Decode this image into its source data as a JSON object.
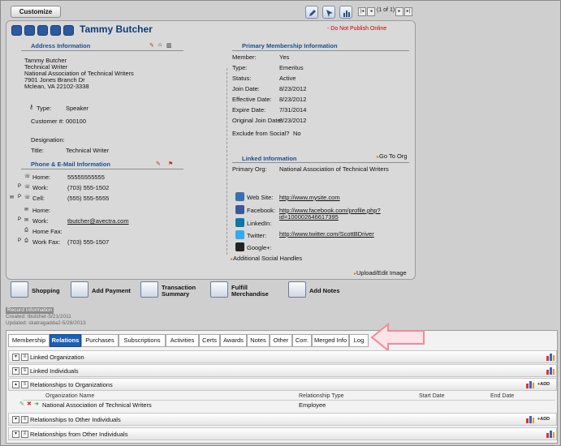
{
  "toolbar": {
    "customize_label": "Customize",
    "pager_text": "(1 of 1)",
    "icons": [
      "edit-icon",
      "pointer-icon",
      "report-chart-icon"
    ]
  },
  "record": {
    "name": "Tammy Butcher",
    "do_not_publish": "- Do Not Publish Online"
  },
  "address": {
    "section_title": "Address Information",
    "lines": [
      "Tammy Butcher",
      "Technical Writer",
      "National Association of Technical Writers",
      "7901 Jones Branch Dr",
      "Mclean, VA 22102-3338"
    ],
    "type_label": "Type:",
    "type_value": "Speaker",
    "customer_label": "Customer #:",
    "customer_value": "000100",
    "designation_label": "Designation:",
    "title_label": "Title:",
    "title_value": "Technical Writer"
  },
  "phone": {
    "section_title": "Phone & E-Mail Information",
    "rows": [
      {
        "label": "Home:",
        "value": "55555555555",
        "prefix": ""
      },
      {
        "label": "Work:",
        "value": "(703) 555-1502",
        "prefix": "P"
      },
      {
        "label": "Cell:",
        "value": "(555) 555-5555",
        "prefix": "P"
      },
      {
        "label": "Home:",
        "value": "",
        "prefix": ""
      },
      {
        "label": "Work:",
        "value": "tbutcher@avectra.com",
        "prefix": "P"
      },
      {
        "label": "Home Fax:",
        "value": "",
        "prefix": ""
      },
      {
        "label": "Work Fax:",
        "value": "(703) 555-1507",
        "prefix": "P"
      }
    ]
  },
  "membership": {
    "section_title": "Primary Membership Information",
    "rows": [
      {
        "label": "Member:",
        "value": "Yes"
      },
      {
        "label": "Type:",
        "value": "Emeritus"
      },
      {
        "label": "Status:",
        "value": "Active"
      },
      {
        "label": "Join Date:",
        "value": "8/23/2012"
      },
      {
        "label": "Effective Date:",
        "value": "8/23/2012"
      },
      {
        "label": "Expire Date:",
        "value": "7/31/2014"
      },
      {
        "label": "Original Join Date:",
        "value": "8/23/2012"
      },
      {
        "label": "Exclude from Social?",
        "value": "No"
      }
    ]
  },
  "linked": {
    "section_title": "Linked Information",
    "go_to_org": "Go To Org",
    "primary_org_label": "Primary Org:",
    "primary_org_value": "National Association of Technical Writers"
  },
  "social": {
    "rows": [
      {
        "label": "Web Site:",
        "value": "http://www.mysite.com",
        "color": "#3a6fb0"
      },
      {
        "label": "Facebook:",
        "value": "http://www.facebook.com/profile.php?",
        "value2": "id=100002646617395",
        "color": "#3b5998"
      },
      {
        "label": "LinkedIn:",
        "value": "",
        "color": "#0e76a8"
      },
      {
        "label": "Twitter:",
        "value": "http://www.twitter.com/ScottBDriver",
        "color": "#33aaee"
      },
      {
        "label": "Google+:",
        "value": "",
        "color": "#222222"
      }
    ],
    "additional": "Additional Social Handles",
    "upload": "Upload/Edit Image"
  },
  "actions": [
    {
      "label": "Shopping",
      "icon": "shopping-cart-icon"
    },
    {
      "label": "Add Payment",
      "icon": "payment-card-icon"
    },
    {
      "label": "Transaction",
      "label2": "Summary",
      "icon": "transaction-chart-icon"
    },
    {
      "label": "Fulfill",
      "label2": "Merchandise",
      "icon": "fulfill-box-icon"
    },
    {
      "label": "Add Notes",
      "icon": "notes-icon"
    }
  ],
  "record_info": {
    "header": "Record Information",
    "created": "Created: tbutcher-5/21/2011",
    "updated": "Updated: skatragadda2-5/28/2013"
  },
  "tabs": [
    "Membership",
    "Relations",
    "Purchases",
    "Subscriptions",
    "Activities",
    "Certs",
    "Awards",
    "Notes",
    "Other",
    "Corr.",
    "Merged Info",
    "Log"
  ],
  "active_tab": "Relations",
  "relations": {
    "sections": [
      "Linked Organization",
      "Linked Individuals",
      "Relationships to Organizations",
      "Relationships to Other Individuals",
      "Relationships from Other Individuals"
    ],
    "add_label": "ADD",
    "columns": [
      "Organization Name",
      "Relationship Type",
      "Start Date",
      "End Date"
    ],
    "org_rows": [
      {
        "org": "National Association of Technical Writers",
        "type": "Employee",
        "start": "",
        "end": ""
      }
    ]
  },
  "colors": {
    "accent": "#1d5fb5",
    "title": "#0c3b7c",
    "alert": "#c00000",
    "callout_arrow": "#f28a9a"
  }
}
